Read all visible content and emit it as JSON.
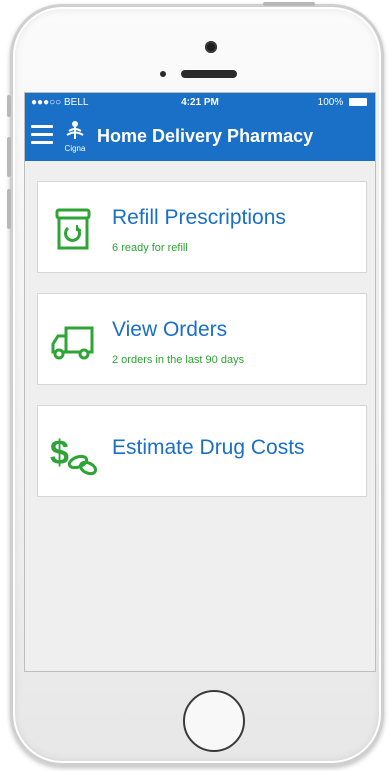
{
  "status": {
    "carrier": "●●●○○ BELL",
    "time": "4:21 PM",
    "battery": "100%"
  },
  "nav": {
    "title": "Home Delivery Pharmacy",
    "logo_text": "Cigna"
  },
  "cards": [
    {
      "title": "Refill Prescriptions",
      "subtitle": "6 ready for refill",
      "icon": "prescription-bottle-icon"
    },
    {
      "title": "View Orders",
      "subtitle": "2 orders in the last 90 days",
      "icon": "delivery-truck-icon"
    },
    {
      "title": "Estimate Drug Costs",
      "icon": "dollar-pills-icon"
    }
  ],
  "colors": {
    "header": "#1a6fc6",
    "accent_green": "#2ea436",
    "title_blue": "#1a6fc6"
  }
}
